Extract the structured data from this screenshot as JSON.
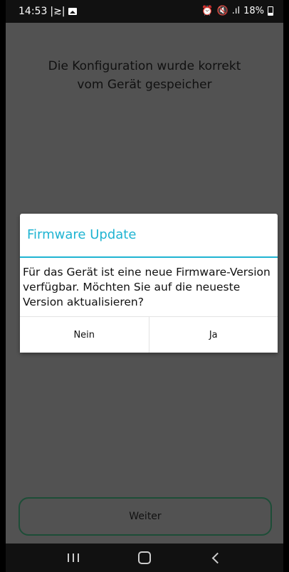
{
  "status_bar": {
    "time": "14:53",
    "left_icons": [
      "|≳|",
      "gallery-icon"
    ],
    "right_text": "⏰ 🔇 ⁹⁸ .ıl 18%",
    "battery_percent": "18%"
  },
  "main": {
    "message_line1": "Die Konfiguration wurde korrekt",
    "message_line2": "vom Gerät gespeicher",
    "continue_label": "Weiter"
  },
  "dialog": {
    "title": "Firmware Update",
    "body": "Für das Gerät ist eine neue Firmware-Version verfügbar. Möchten Sie auf die neueste Version aktualisieren?",
    "negative_label": "Nein",
    "positive_label": "Ja"
  },
  "colors": {
    "accent": "#1fb4d2",
    "background": "#525252",
    "button_border": "#1d4d37"
  },
  "navigation": [
    "recents-icon",
    "home-icon",
    "back-icon"
  ]
}
